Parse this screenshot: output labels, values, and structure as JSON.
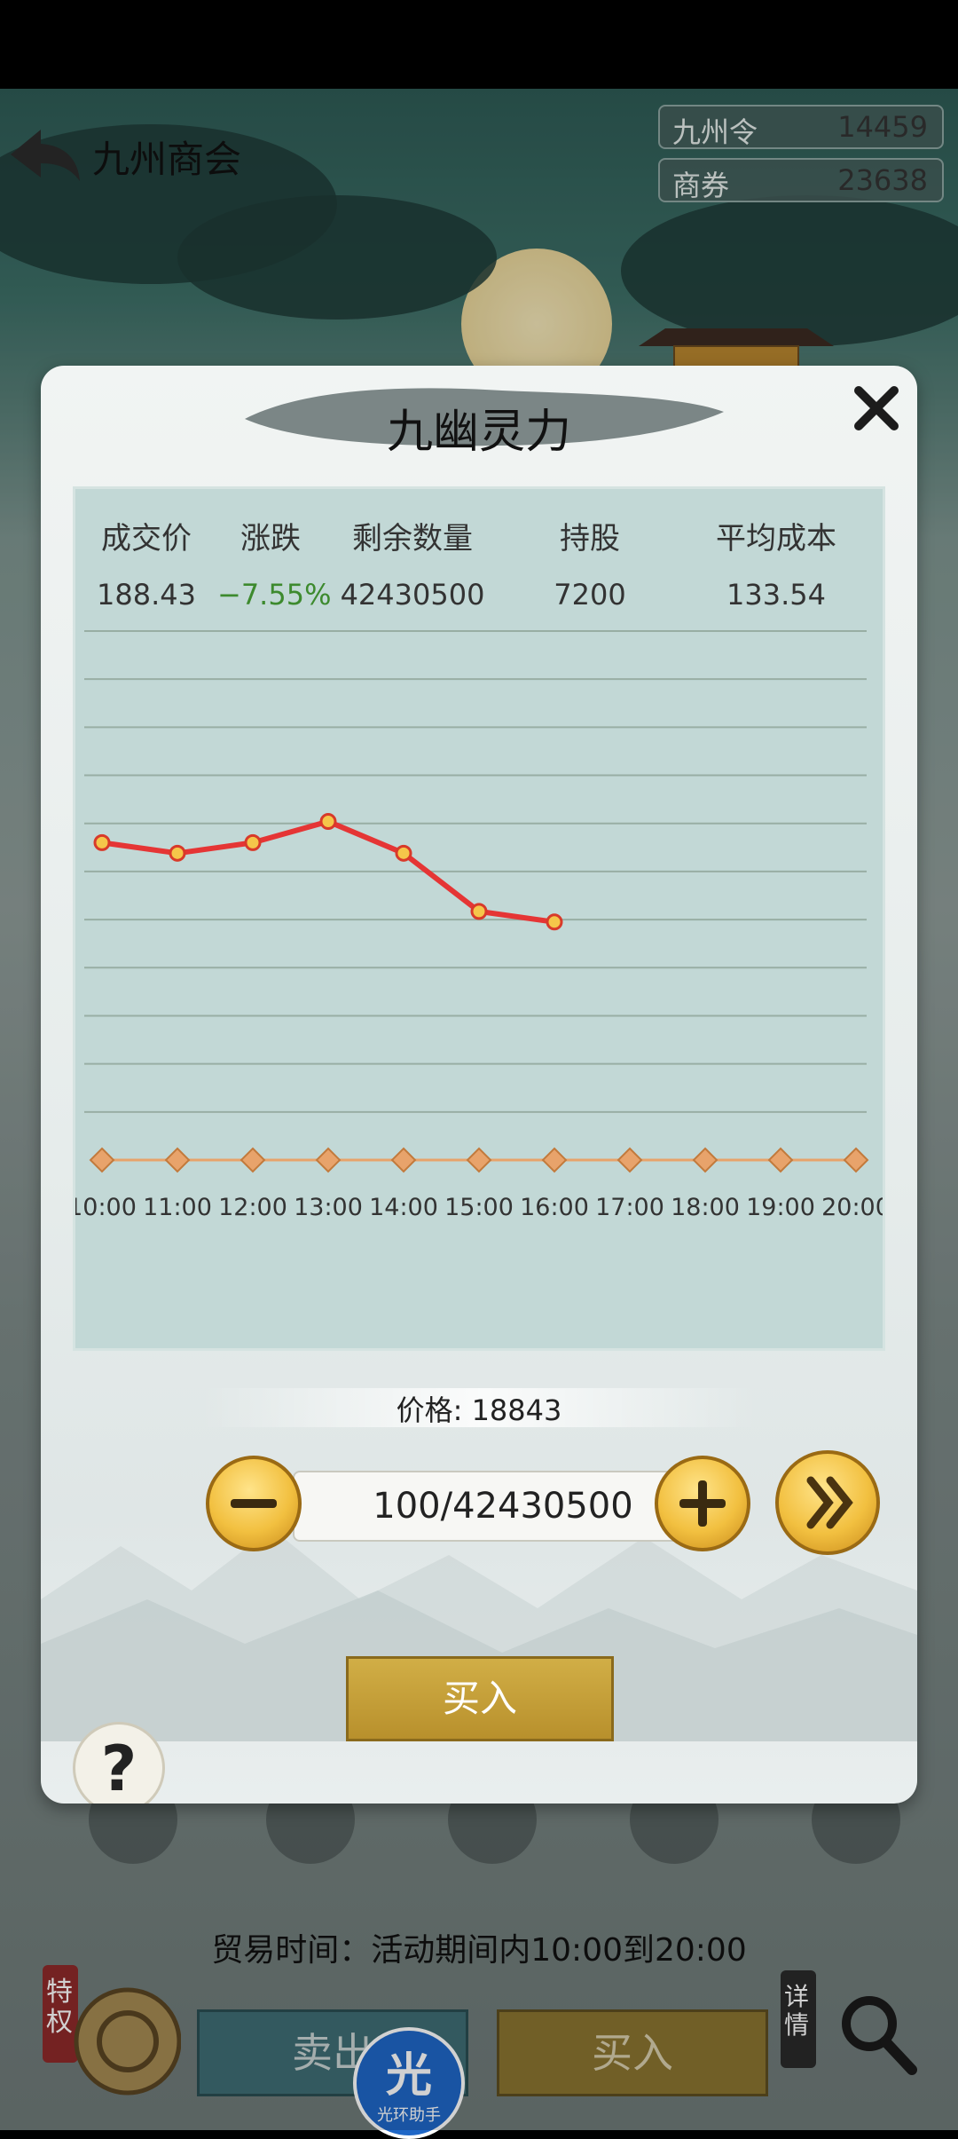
{
  "header": {
    "title": "九州商会",
    "currencies": [
      {
        "label": "九州令",
        "value": "14459"
      },
      {
        "label": "商券",
        "value": "23638"
      }
    ]
  },
  "dialog": {
    "title": "九幽灵力",
    "stats": {
      "headers": [
        "成交价",
        "涨跌",
        "剩余数量",
        "持股",
        "平均成本"
      ],
      "values": [
        "188.43",
        "−7.55%",
        "42430500",
        "7200",
        "133.54"
      ]
    },
    "price_label": "价格: 18843",
    "quantity_value": "100/42430500",
    "buy_label": "买入",
    "help_label": "?"
  },
  "chart_data": {
    "type": "line",
    "x": [
      "10:00",
      "11:00",
      "12:00",
      "13:00",
      "14:00",
      "15:00",
      "16:00",
      "17:00",
      "18:00",
      "19:00",
      "20:00"
    ],
    "values": [
      0.6,
      0.58,
      0.6,
      0.64,
      0.58,
      0.47,
      0.45
    ],
    "ylim": [
      0,
      1
    ],
    "grid": true,
    "line_color": "#e53535",
    "baseline_color": "#e8a36b",
    "title": "",
    "xlabel": "",
    "ylabel": ""
  },
  "footer": {
    "trade_time": "贸易时间：活动期间内10:00到20:00",
    "sell_label": "卖出",
    "buy_label": "买入",
    "privilege_label": "特权",
    "details_label": "详情",
    "assistant_label": "光环助手",
    "assistant_icon_char": "光"
  },
  "colors": {
    "accent_green": "#3d8a2e",
    "gold": "#f2c040"
  }
}
